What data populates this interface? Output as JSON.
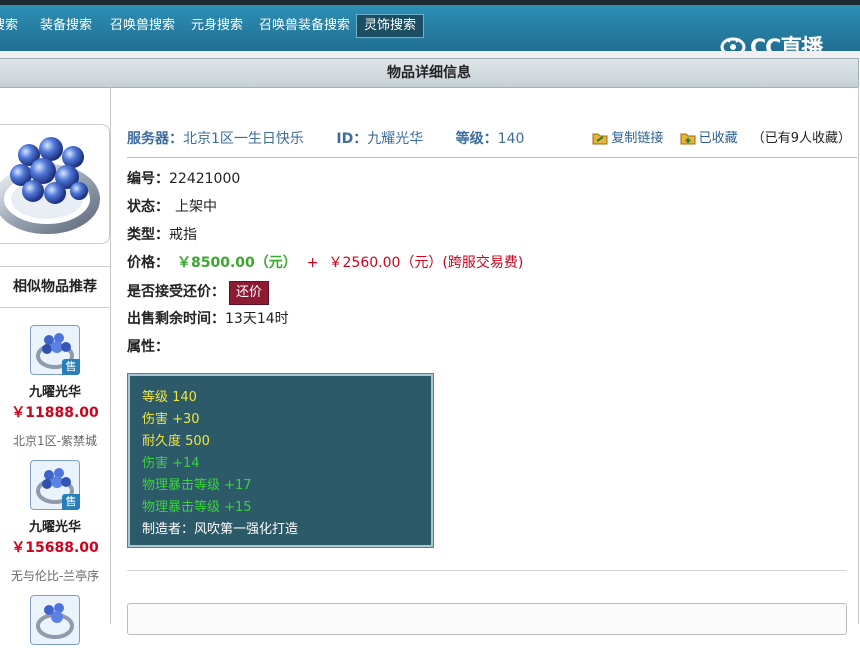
{
  "nav": {
    "tabs": [
      {
        "label": "搜索"
      },
      {
        "label": "装备搜索"
      },
      {
        "label": "召唤兽搜索"
      },
      {
        "label": "元身搜索"
      },
      {
        "label": "召唤兽装备搜索"
      },
      {
        "label": "灵饰搜索",
        "active": true
      }
    ]
  },
  "watermark": {
    "text": "CC直播"
  },
  "page_header": {
    "title": "物品详细信息"
  },
  "item": {
    "server_label": "服务器：",
    "server_value": "北京1区一生日快乐",
    "id_label": "ID：",
    "id_value": "九耀光华",
    "level_label": "等级：",
    "level_value": "140",
    "actions": {
      "copy_link": "复制链接",
      "favorited": "已收藏",
      "fav_count_text": "（已有9人收藏）"
    },
    "fields": {
      "serial_label": "编号：",
      "serial_value": "22421000",
      "status_label": "状态：",
      "status_value": "上架中",
      "type_label": "类型：",
      "type_value": "戒指",
      "price_label": "价格：",
      "price_main": "￥8500.00（元）",
      "price_plus": "+",
      "price_fee": "￥2560.00（元）(跨服交易费)",
      "haggle_label": "是否接受还价：",
      "haggle_button": "还价",
      "remaining_label": "出售剩余时间：",
      "remaining_value": "13天14时",
      "attributes_label": "属性："
    },
    "attributes": [
      {
        "text": "等级 140",
        "color": "#f0e442"
      },
      {
        "text": "伤害 +30",
        "color": "#f0e442"
      },
      {
        "text": "耐久度 500",
        "color": "#f0e442"
      },
      {
        "text": "伤害 +14",
        "color": "#39d33c"
      },
      {
        "text": "物理暴击等级 +17",
        "color": "#39d33c"
      },
      {
        "text": "物理暴击等级 +15",
        "color": "#39d33c"
      },
      {
        "text": "制造者：风吹第一强化打造",
        "color": "#ffffff"
      }
    ]
  },
  "sidebar": {
    "title": "相似物品推荐",
    "sale_badge": "售",
    "recommendations": [
      {
        "name": "九曜光华",
        "price": "￥11888.00",
        "server": "北京1区-紫禁城"
      },
      {
        "name": "九曜光华",
        "price": "￥15688.00",
        "server": "无与伦比-兰亭序"
      }
    ]
  }
}
